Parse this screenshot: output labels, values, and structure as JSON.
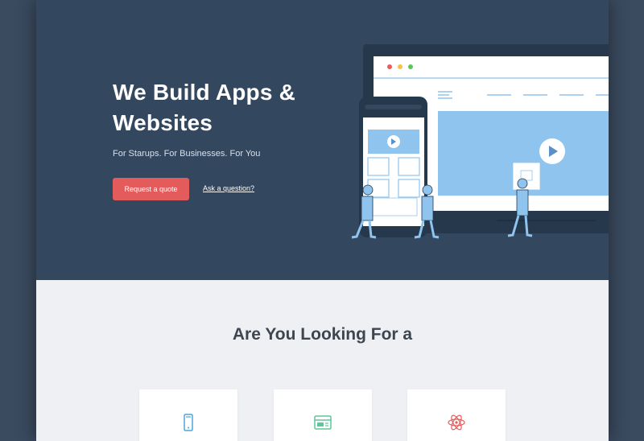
{
  "hero": {
    "title": "We Build Apps & Websites",
    "tagline": "For Starups. For Businesses. For You",
    "primary_button": "Request a quote",
    "secondary_link": "Ask a question?"
  },
  "section": {
    "title": "Are You Looking For a",
    "cards": [
      {
        "icon": "mobile-phone-icon"
      },
      {
        "icon": "browser-window-icon"
      },
      {
        "icon": "atom-icon"
      }
    ]
  },
  "colors": {
    "hero_bg": "#33475e",
    "page_bg": "#3a4a5f",
    "accent_red": "#e45b5b",
    "illustration_blue": "#8fc4ef",
    "section_bg": "#eef0f3"
  }
}
